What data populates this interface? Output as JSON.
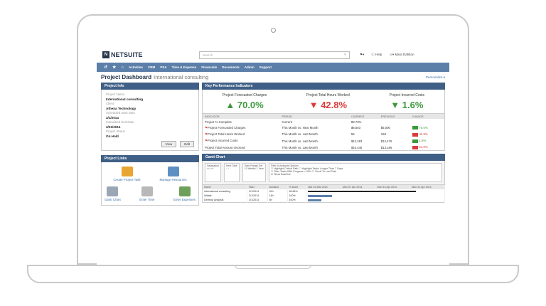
{
  "brand": {
    "logo_mark": "N",
    "logo_text": "NETSUITE"
  },
  "search": {
    "placeholder": "Search"
  },
  "topbar": {
    "help": "Help",
    "user": "Mara Dahlton"
  },
  "nav": {
    "items": [
      "Activities",
      "CRM",
      "PSA",
      "Time & Expense",
      "Financials",
      "Documents",
      "Admin",
      "Support"
    ]
  },
  "page": {
    "title": "Project Dashboard",
    "subtitle": "International consulting",
    "personalize": "Personalize"
  },
  "project_info": {
    "header": "Project Info",
    "fields": [
      {
        "label": "Project Name",
        "value": "International consulting"
      },
      {
        "label": "Client",
        "value": "Athena Technology"
      },
      {
        "label": "Scheduled Start Date",
        "value": "3/1/2014"
      },
      {
        "label": "Calculated End Date",
        "value": "3/31/2014"
      },
      {
        "label": "Project Status",
        "value": "On Hold"
      }
    ],
    "view_label": "View",
    "edit_label": "Edit"
  },
  "project_links": {
    "header": "Project Links",
    "items": [
      "Create Project Task",
      "Manage Resources",
      "Gantt Chart",
      "Enter Time",
      "Enter Expenses"
    ]
  },
  "kpi": {
    "header": "Key Performance Indicators",
    "cards": [
      {
        "label": "Project Forecasted Charges",
        "value": "70.0%",
        "dir": "up"
      },
      {
        "label": "Project Total Hours Worked",
        "value": "42.8%",
        "dir": "down"
      },
      {
        "label": "Project Incurred Costs",
        "value": "1.6%",
        "dir": "down"
      }
    ],
    "columns": [
      "INDICATOR",
      "PERIOD",
      "CURRENT",
      "PREVIOUS",
      "CHANGE"
    ],
    "rows": [
      {
        "indicator": "Project % Complete",
        "period": "Current",
        "current": "88.73%",
        "previous": "",
        "change": ""
      },
      {
        "indicator": "Project Forecasted Charges",
        "period": "This Month vs. Next Month",
        "current": "$8,503",
        "previous": "$5,000",
        "change": "70.0%",
        "color": "#3c9a3c"
      },
      {
        "indicator": "Project Total Hours Worked",
        "period": "This Month vs. Last Month",
        "current": "55",
        "previous": "168",
        "change": "42.8%",
        "color": "#d93c3c"
      },
      {
        "indicator": "Project Incurred Costs",
        "period": "This Month vs. Last Month",
        "current": "$12,283",
        "previous": "$12,476",
        "change": "1.6%",
        "color": "#3c9a3c"
      },
      {
        "indicator": "Project Total Amount Invoiced",
        "period": "This Month vs. Last Month",
        "current": "$10,445",
        "previous": "$13,186",
        "change": "21.0%",
        "color": "#d93c3c"
      }
    ]
  },
  "gantt": {
    "header": "Gantt Chart",
    "navigation": "Navigation",
    "next_task": "Next Task",
    "date_range": "Date Range Set",
    "filter": "Filter & Analysis Options",
    "opt_critical": "Highlight Critical Path",
    "opt_progress": "Filter Tasks With Progress > 50%",
    "opt_baseline": "Show Baseline",
    "opt_longer": "Highlight Tasks Longer Than 7 Days",
    "opt_scroll": "Scroll To Last Task",
    "weeks": "10 Weeks",
    "year": "1 Year",
    "cols": [
      "Name",
      "Start",
      "Duration",
      "% Done"
    ],
    "weekhdr": [
      "Mar 31 Mar 2014",
      "Mon 07 Apr 2014",
      "Mon 14 Apr 2014",
      "Mon 21 Apr 2014"
    ],
    "rows": [
      {
        "name": "International consulting",
        "start": "3/1/2014",
        "dur": "40h",
        "done": "84.84%"
      },
      {
        "name": "Initiate",
        "start": "3/1/2014",
        "dur": "16h",
        "done": "100%"
      },
      {
        "name": "Develop Analysis",
        "start": "3/1/2014",
        "dur": "8h",
        "done": "100%"
      }
    ]
  }
}
